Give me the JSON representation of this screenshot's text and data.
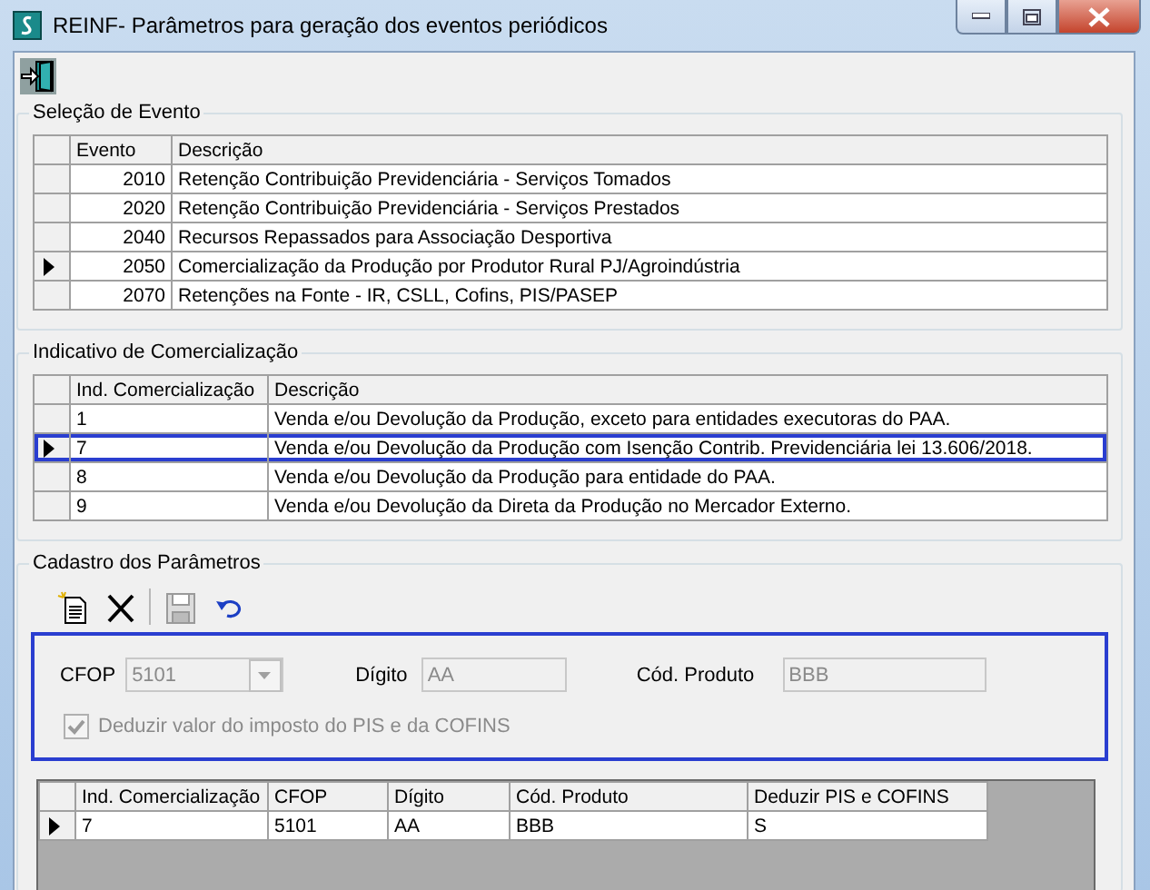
{
  "window": {
    "title": "REINF- Parâmetros para geração dos eventos periódicos"
  },
  "event_group": {
    "title": "Seleção de Evento",
    "columns": [
      "Evento",
      "Descrição"
    ],
    "rows": [
      {
        "cells": [
          "2010",
          "Retenção Contribuição Previdenciária - Serviços Tomados"
        ],
        "selected": false
      },
      {
        "cells": [
          "2020",
          "Retenção Contribuição Previdenciária - Serviços Prestados"
        ],
        "selected": false
      },
      {
        "cells": [
          "2040",
          "Recursos Repassados para Associação Desportiva"
        ],
        "selected": false
      },
      {
        "cells": [
          "2050",
          "Comercialização da Produção por Produtor Rural PJ/Agroindústria"
        ],
        "selected": true
      },
      {
        "cells": [
          "2070",
          "Retenções na Fonte - IR, CSLL, Cofins, PIS/PASEP"
        ],
        "selected": false
      }
    ]
  },
  "indicator_group": {
    "title": "Indicativo de Comercialização",
    "focused": true,
    "columns": [
      "Ind. Comercialização",
      "Descrição"
    ],
    "rows": [
      {
        "cells": [
          "1",
          "Venda e/ou Devolução da Produção, exceto para entidades executoras do PAA."
        ],
        "selected": false
      },
      {
        "cells": [
          "7",
          "Venda e/ou Devolução da Produção com Isenção Contrib. Previdenciária lei 13.606/2018."
        ],
        "selected": true
      },
      {
        "cells": [
          "8",
          "Venda e/ou Devolução da Produção para entidade do PAA."
        ],
        "selected": false
      },
      {
        "cells": [
          "9",
          "Venda e/ou Devolução da Direta da Produção no Mercador Externo."
        ],
        "selected": false
      }
    ]
  },
  "params_group": {
    "title": "Cadastro dos Parâmetros",
    "toolbar": [
      {
        "kind": "new",
        "disabled": false
      },
      {
        "kind": "delete",
        "disabled": false
      },
      {
        "kind": "save",
        "disabled": true
      },
      {
        "kind": "undo",
        "disabled": false
      }
    ],
    "form": {
      "disabled": true,
      "cfop": {
        "label": "CFOP",
        "value": "5101"
      },
      "digit": {
        "label": "Dígito",
        "value": "AA"
      },
      "product_code": {
        "label": "Cód. Produto",
        "value": "BBB"
      },
      "deduct": {
        "label": "Deduzir valor do imposto do PIS e da COFINS",
        "checked": true
      }
    },
    "table": {
      "columns": [
        "Ind. Comercialização",
        "CFOP",
        "Dígito",
        "Cód. Produto",
        "Deduzir PIS e COFINS"
      ],
      "rows": [
        {
          "cells": [
            "7",
            "5101",
            "AA",
            "BBB",
            "S"
          ],
          "selected": true
        }
      ]
    }
  }
}
